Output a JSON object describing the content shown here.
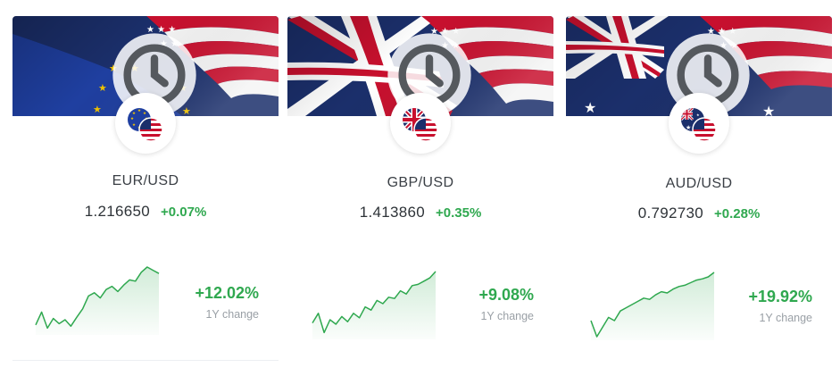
{
  "cards": [
    {
      "pair": "EUR/USD",
      "price": "1.216650",
      "change": "+0.07%",
      "year_change": "+12.02%",
      "year_label": "1Y change",
      "base_flag": "eu-flag-icon",
      "quote_flag": "us-flag-icon",
      "trend": [
        0.1,
        0.3,
        0.05,
        0.2,
        0.12,
        0.18,
        0.08,
        0.22,
        0.35,
        0.55,
        0.6,
        0.52,
        0.65,
        0.7,
        0.62,
        0.72,
        0.8,
        0.78,
        0.92,
        1.0,
        0.95,
        0.9
      ]
    },
    {
      "pair": "GBP/USD",
      "price": "1.413860",
      "change": "+0.35%",
      "year_change": "+9.08%",
      "year_label": "1Y change",
      "base_flag": "uk-flag-icon",
      "quote_flag": "us-flag-icon",
      "trend": [
        0.2,
        0.35,
        0.05,
        0.25,
        0.18,
        0.3,
        0.22,
        0.35,
        0.28,
        0.45,
        0.4,
        0.55,
        0.5,
        0.6,
        0.58,
        0.7,
        0.65,
        0.78,
        0.8,
        0.85,
        0.9,
        1.0
      ]
    },
    {
      "pair": "AUD/USD",
      "price": "0.792730",
      "change": "+0.28%",
      "year_change": "+19.92%",
      "year_label": "1Y change",
      "base_flag": "au-flag-icon",
      "quote_flag": "us-flag-icon",
      "trend": [
        0.25,
        0.0,
        0.15,
        0.3,
        0.25,
        0.4,
        0.45,
        0.5,
        0.55,
        0.6,
        0.58,
        0.65,
        0.7,
        0.68,
        0.74,
        0.78,
        0.8,
        0.84,
        0.88,
        0.9,
        0.93,
        1.0
      ]
    }
  ],
  "colors": {
    "positive": "#2fa84f",
    "us_red": "#c8102e",
    "us_blue": "#1b2f6b",
    "eu_blue": "#1f3fa0",
    "eu_star": "#f2c400",
    "uk_blue": "#1b2f6b",
    "au_blue": "#1b2f6b"
  }
}
